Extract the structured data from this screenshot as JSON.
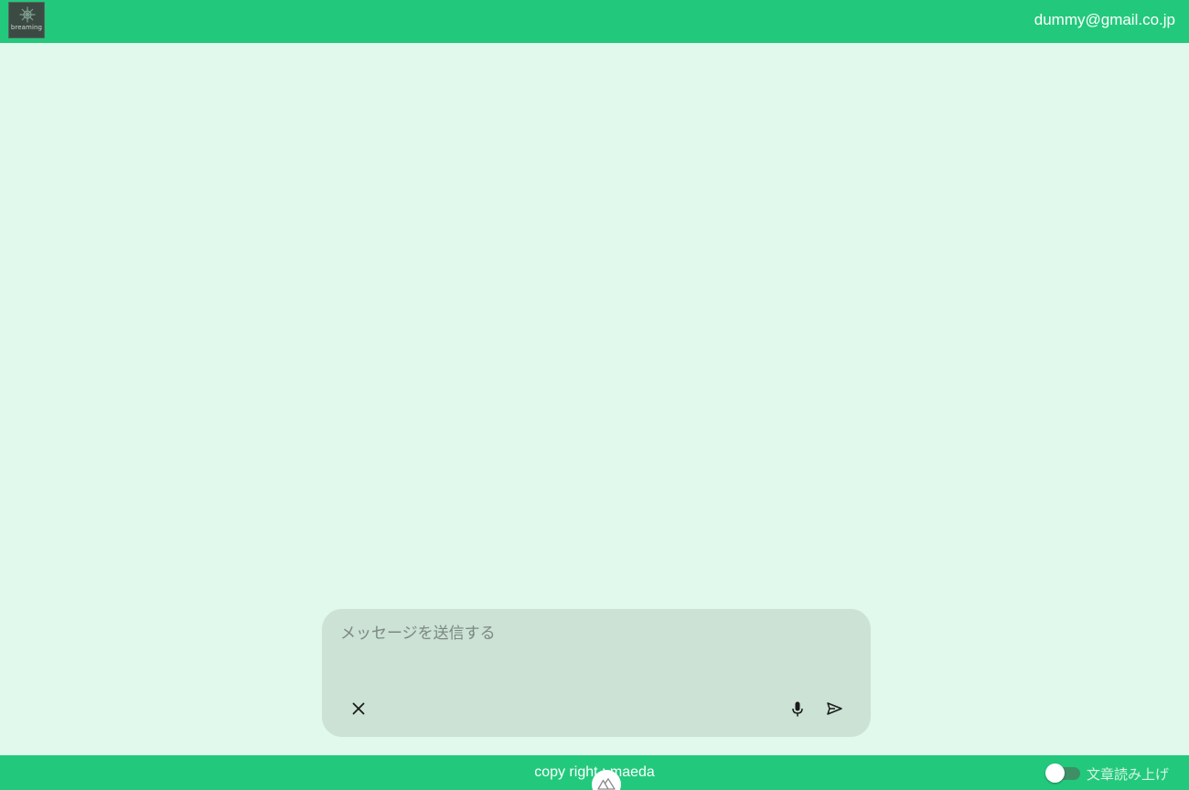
{
  "header": {
    "logo_text": "breaming",
    "user_email": "dummy@gmail.co.jp"
  },
  "composer": {
    "placeholder": "メッセージを送信する",
    "value": "",
    "icons": {
      "clear": "close-icon",
      "mic": "microphone-icon",
      "send": "send-icon"
    }
  },
  "footer": {
    "copyright": "copy right  : maeda",
    "tts_label": "文章読み上げ",
    "tts_enabled": false,
    "badge_icon": "nuxt-icon"
  },
  "colors": {
    "primary": "#22c97c",
    "background": "#e1f9ec",
    "composer": "#cbe2d5"
  }
}
